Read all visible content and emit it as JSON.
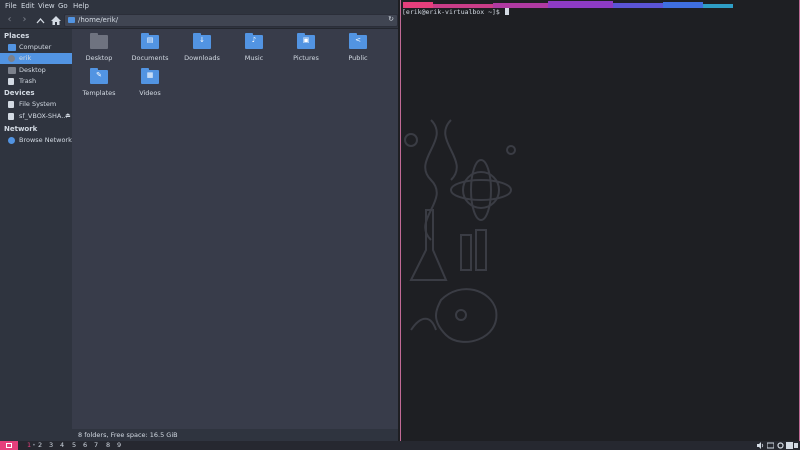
{
  "menubar": {
    "file": "File",
    "edit": "Edit",
    "view": "View",
    "go": "Go",
    "help": "Help"
  },
  "toolbar": {
    "path": "/home/erik/"
  },
  "sidebar": {
    "places_title": "Places",
    "places": [
      {
        "label": "Computer"
      },
      {
        "label": "erik"
      },
      {
        "label": "Desktop"
      },
      {
        "label": "Trash"
      }
    ],
    "devices_title": "Devices",
    "devices": [
      {
        "label": "File System"
      },
      {
        "label": "sf_VBOX-SHA..."
      }
    ],
    "network_title": "Network",
    "network": [
      {
        "label": "Browse Network"
      }
    ]
  },
  "files": [
    {
      "name": "Desktop"
    },
    {
      "name": "Documents"
    },
    {
      "name": "Downloads"
    },
    {
      "name": "Music"
    },
    {
      "name": "Pictures"
    },
    {
      "name": "Public"
    },
    {
      "name": "Templates"
    },
    {
      "name": "Videos"
    }
  ],
  "status": "8 folders, Free space: 16.5 GiB",
  "terminal": {
    "prompt": "[erik@erik-virtualbox ~]$ "
  },
  "panel": {
    "workspaces": [
      "1",
      "2",
      "3",
      "4",
      "5",
      "6",
      "7",
      "8",
      "9"
    ]
  },
  "colors": {
    "accent": "#5294e2",
    "pink": "#e63f7c",
    "bg": "#383c4a",
    "sidebar": "#2f343f"
  }
}
